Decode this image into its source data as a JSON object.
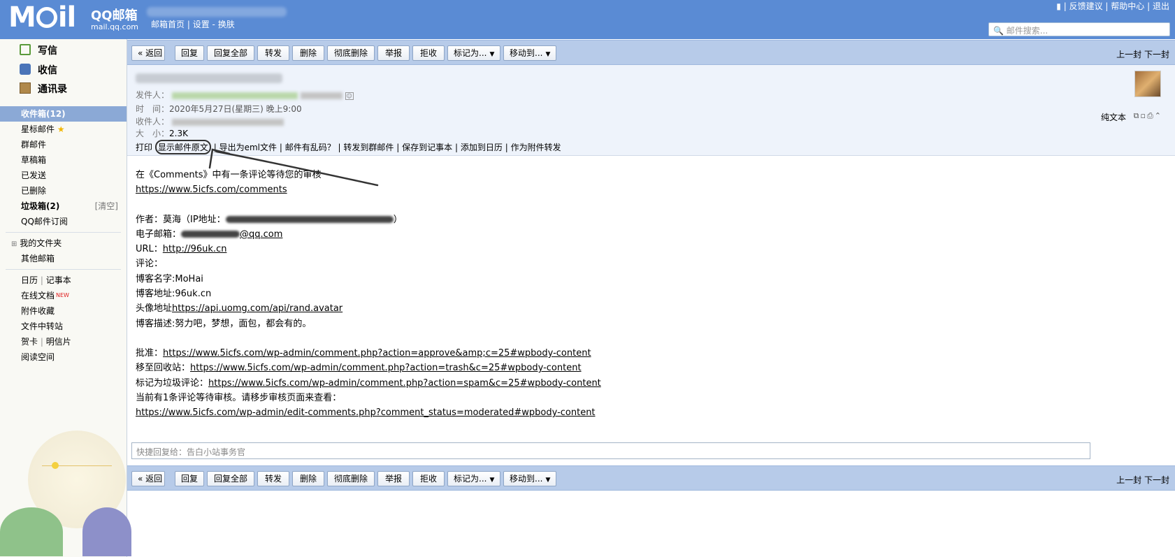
{
  "topbar": {
    "logo_brand": "QQ邮箱",
    "logo_domain": "mail.qq.com",
    "links": [
      "邮箱首页",
      "设置",
      "换肤"
    ],
    "right_links": [
      "反馈建议",
      "帮助中心",
      "退出"
    ],
    "search_placeholder": "邮件搜索..."
  },
  "sidebar": {
    "quick": [
      "写信",
      "收信",
      "通讯录"
    ],
    "folders": [
      {
        "label": "收件箱(12)"
      },
      {
        "label": "星标邮件"
      },
      {
        "label": "群邮件"
      },
      {
        "label": "草稿箱"
      },
      {
        "label": "已发送"
      },
      {
        "label": "已删除"
      },
      {
        "label": "垃圾箱(2)",
        "action": "[清空]"
      },
      {
        "label": "QQ邮件订阅"
      }
    ],
    "extra": [
      "我的文件夹",
      "其他邮箱"
    ],
    "tools": [
      {
        "label": "日历",
        "label2": "记事本"
      },
      {
        "label": "在线文档",
        "badge": "NEW"
      },
      {
        "label": "附件收藏"
      },
      {
        "label": "文件中转站"
      },
      {
        "label": "贺卡",
        "label2": "明信片"
      },
      {
        "label": "阅读空间"
      }
    ]
  },
  "toolbar": {
    "buttons": [
      "« 返回",
      "回复",
      "回复全部",
      "转发",
      "删除",
      "彻底删除",
      "举报",
      "拒收",
      "标记为...",
      "移动到..."
    ],
    "prev": "上一封",
    "next": "下一封"
  },
  "header": {
    "from_label": "发件人：",
    "time_label": "时　间：",
    "time_value": "2020年5月27日(星期三) 晚上9:00",
    "to_label": "收件人：",
    "size_label": "大　小：",
    "size_value": "2.3K",
    "actions": [
      "打印",
      "显示邮件原文",
      "导出为eml文件",
      "邮件有乱码？",
      "转发到群邮件",
      "保存到记事本",
      "添加到日历",
      "作为附件转发"
    ],
    "plain_text": "纯文本"
  },
  "body": {
    "line1": "在《Comments》中有一条评论等待您的审核",
    "link1": "https://www.5icfs.com/comments",
    "author_label": "作者：莫海（IP地址：",
    "author_tail": "）",
    "email_label": "电子邮箱：",
    "email_tail": "@qq.com",
    "url_label": "URL：",
    "url_value": "http://96uk.cn",
    "comment_label": "评论：",
    "blog_name": "博客名字:MoHai",
    "blog_addr": "博客地址:96uk.cn",
    "avatar_label": "头像地址",
    "avatar_link": "https://api.uomg.com/api/rand.avatar",
    "blog_desc": "博客描述:努力吧，梦想，面包，都会有的。",
    "approve_label": "批准：",
    "approve_link": "https://www.5icfs.com/wp-admin/comment.php?action=approve&amp;c=25#wpbody-content",
    "trash_label": "移至回收站：",
    "trash_link": "https://www.5icfs.com/wp-admin/comment.php?action=trash&c=25#wpbody-content",
    "spam_label": "标记为垃圾评论：",
    "spam_link": "https://www.5icfs.com/wp-admin/comment.php?action=spam&c=25#wpbody-content",
    "pending": "当前有1条评论等待审核。请移步审核页面来查看：",
    "pending_link": "https://www.5icfs.com/wp-admin/edit-comments.php?comment_status=moderated#wpbody-content"
  },
  "reply": {
    "placeholder": "快捷回复给：告白小站事务官"
  }
}
